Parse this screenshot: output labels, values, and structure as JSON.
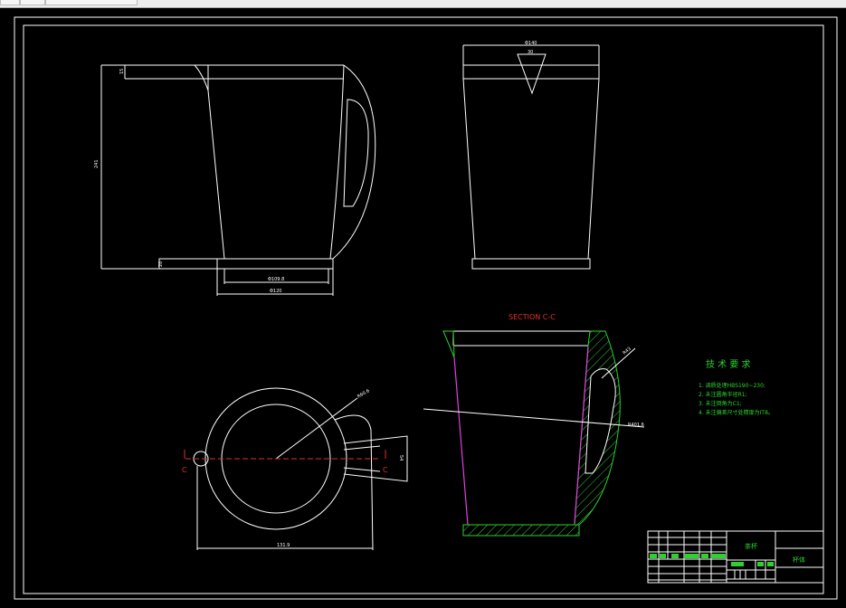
{
  "section_title": "SECTION C-C",
  "section_marker": "C",
  "tech_requirements": {
    "title": "技 术 要 求",
    "items": [
      "1. 调质处理HBS190~230;",
      "2. 未注圆角半径R1;",
      "3. 未注倒角为C1;",
      "4. 未注偏差尺寸处精度为IT8。"
    ]
  },
  "dimensions": {
    "height": "241",
    "rim": "15",
    "base": "20",
    "base_inner": "Φ109.8",
    "base_outer": "Φ120",
    "top_width": "Φ140",
    "spout": "30",
    "top_radius": "R60.6",
    "handle": "54",
    "top_view_width": "131.9",
    "section_radius": "R401.6",
    "section_handle": "R43"
  },
  "title_block": {
    "part_name": "杯体",
    "drawing_name": "茶杯"
  },
  "colors": {
    "lines": "#ffffff",
    "hatch": "#2fd12f",
    "section": "#e03030",
    "hidden": "#e040e0"
  }
}
